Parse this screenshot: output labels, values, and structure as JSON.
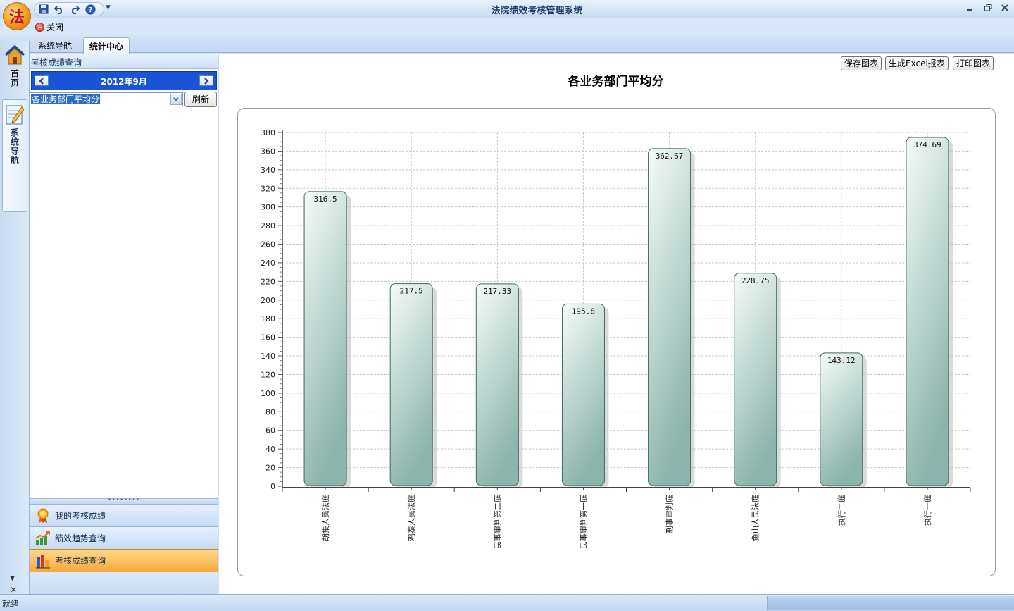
{
  "app": {
    "title": "法院绩效考核管理系统",
    "logo_char": "法"
  },
  "ribbon": {
    "close_label": "关闭"
  },
  "tabs": [
    {
      "label": "系统导航",
      "active": false
    },
    {
      "label": "统计中心",
      "active": true
    }
  ],
  "vertical_nav": {
    "home_label": "首页",
    "nav_label": "系统导航"
  },
  "left_panel": {
    "header": "考核成绩查询",
    "month": "2012年9月",
    "report_selected": "各业务部门平均分",
    "refresh_label": "刷新",
    "splitter_grip": "••••••••",
    "nav_items": [
      {
        "label": "我的考核成绩",
        "icon": "medal-icon",
        "selected": false
      },
      {
        "label": "绩效趋势查询",
        "icon": "trend-chart-icon",
        "selected": false
      },
      {
        "label": "考核成绩查询",
        "icon": "bar-chart-icon",
        "selected": true
      }
    ]
  },
  "toolbar": {
    "save_chart": "保存图表",
    "export_excel": "生成Excel报表",
    "print_chart": "打印图表"
  },
  "status": {
    "text": "就绪"
  },
  "colors": {
    "bar_top": "#f7fbf9",
    "bar_bottom": "#8bb5ac",
    "bar_stroke": "#3f6a60",
    "selection": "#316ac5",
    "accent_orange": "#f8a93a"
  },
  "chart_data": {
    "type": "bar",
    "title": "各业务部门平均分",
    "xlabel": "",
    "ylabel": "",
    "ylim": [
      0,
      380
    ],
    "ytick_step": 20,
    "grid": true,
    "categories": [
      "胡集人民法庭",
      "鸡泰人民法庭",
      "民事审判第二庭",
      "民事审判第一庭",
      "刑事审判庭",
      "鱼山人民法庭",
      "执行二庭",
      "执行一庭"
    ],
    "values": [
      316.5,
      217.5,
      217.33,
      195.8,
      362.67,
      228.75,
      143.12,
      374.69
    ],
    "value_labels": [
      "316.5",
      "217.5",
      "217.33",
      "195.8",
      "362.67",
      "228.75",
      "143.12",
      "374.69"
    ]
  }
}
